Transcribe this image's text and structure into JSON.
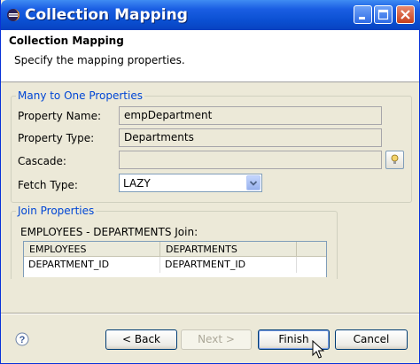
{
  "window": {
    "title": "Collection Mapping"
  },
  "header": {
    "title": "Collection Mapping",
    "description": "Specify the mapping properties."
  },
  "many_to_one": {
    "group_label": "Many to One Properties",
    "property_name_label": "Property Name:",
    "property_name_value": "empDepartment",
    "property_type_label": "Property Type:",
    "property_type_value": "Departments",
    "cascade_label": "Cascade:",
    "cascade_value": "",
    "fetch_type_label": "Fetch Type:",
    "fetch_type_value": "LAZY"
  },
  "join": {
    "group_label": "Join Properties",
    "join_title": "EMPLOYEES - DEPARTMENTS Join:",
    "columns": [
      "EMPLOYEES",
      "DEPARTMENTS"
    ],
    "rows": [
      [
        "DEPARTMENT_ID",
        "DEPARTMENT_ID"
      ]
    ]
  },
  "buttons": {
    "back": "< Back",
    "next": "Next >",
    "finish": "Finish",
    "cancel": "Cancel"
  },
  "colors": {
    "titlebar": "#0a4fd1",
    "group_label": "#0046d5",
    "dialog_bg": "#ece9d8"
  }
}
